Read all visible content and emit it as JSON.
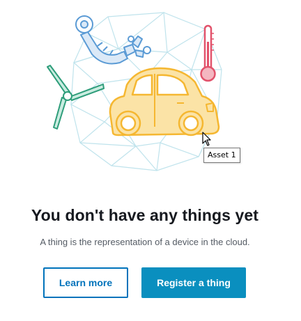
{
  "empty_state": {
    "title": "You don't have any things yet",
    "description": "A thing is the representation of a device in the cloud.",
    "illustration_icons": [
      "globe-mesh",
      "robot-arm",
      "wind-turbine",
      "car",
      "thermometer"
    ],
    "tooltip": "Asset 1"
  },
  "actions": {
    "learn_more_label": "Learn more",
    "register_label": "Register a thing"
  },
  "colors": {
    "primary": "#0a8fbf",
    "link": "#0073bb",
    "car_fill": "#fbe3a6",
    "car_stroke": "#f5b731",
    "arm": "#5b9bd5",
    "turbine": "#2e9d7a",
    "thermometer": "#e2526b",
    "mesh": "#bfe3ec"
  }
}
